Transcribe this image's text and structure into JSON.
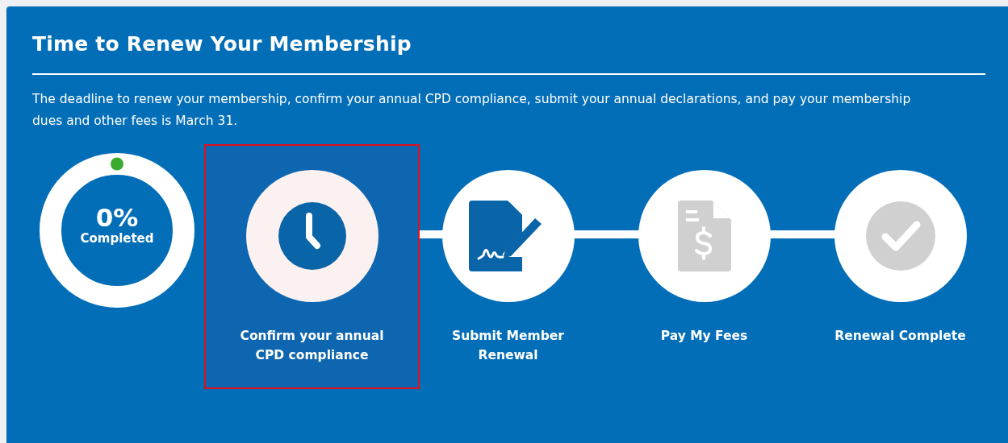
{
  "panel": {
    "title": "Time to Renew Your Membership",
    "description": "The deadline to renew your membership, confirm your annual CPD compliance, submit your annual declarations, and pay your membership dues and other fees is March 31."
  },
  "progress": {
    "percent": "0%",
    "caption": "Completed"
  },
  "steps": [
    {
      "kind": "clock",
      "label": "Confirm your annual CPD compliance",
      "selected": true,
      "enabled": true
    },
    {
      "kind": "sign",
      "label": "Submit Member Renewal",
      "selected": false,
      "enabled": true
    },
    {
      "kind": "fees",
      "label": "Pay My Fees",
      "selected": false,
      "enabled": false
    },
    {
      "kind": "check",
      "label": "Renewal Complete",
      "selected": false,
      "enabled": false
    }
  ]
}
